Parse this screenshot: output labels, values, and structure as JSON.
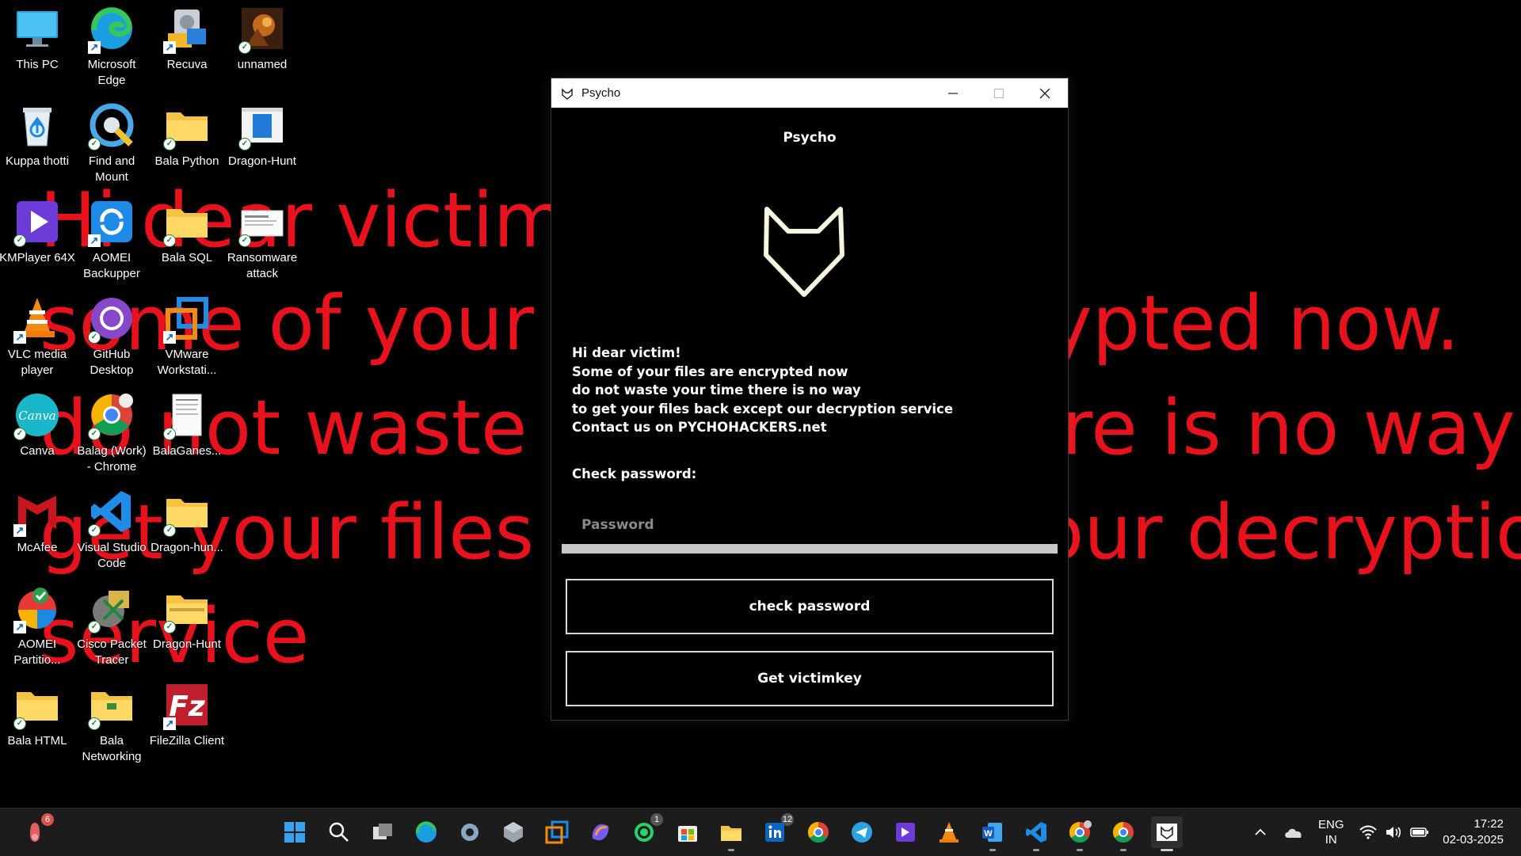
{
  "wallpaper": {
    "lines": [
      "Hi dear victim!",
      "some of your files are encrypted now.",
      "do not waste your time there is no way to",
      "get your files back except our decryption",
      "service"
    ],
    "color": "#e8121c"
  },
  "desktop_icons": [
    {
      "label": "This PC",
      "icon": "monitor-icon"
    },
    {
      "label": "Microsoft Edge",
      "icon": "edge-icon"
    },
    {
      "label": "Recuva",
      "icon": "recuva-icon"
    },
    {
      "label": "unnamed",
      "icon": "image-thumbnail-icon"
    },
    {
      "label": "Kuppa thotti",
      "icon": "recycle-bin-icon"
    },
    {
      "label": "Find and Mount",
      "icon": "find-and-mount-icon"
    },
    {
      "label": "Bala Python",
      "icon": "folder-icon"
    },
    {
      "label": "Dragon-Hunt",
      "icon": "app-icon"
    },
    {
      "label": "KMPlayer 64X",
      "icon": "kmplayer-icon"
    },
    {
      "label": "AOMEI Backupper",
      "icon": "aomei-backupper-icon"
    },
    {
      "label": "Bala SQL",
      "icon": "folder-icon"
    },
    {
      "label": "Ransomware attack",
      "icon": "document-icon"
    },
    {
      "label": "VLC media player",
      "icon": "vlc-icon"
    },
    {
      "label": "GitHub Desktop",
      "icon": "github-icon"
    },
    {
      "label": "VMware Workstati...",
      "icon": "vmware-icon"
    },
    {
      "label": "Canva",
      "icon": "canva-icon"
    },
    {
      "label": "Balag (Work) - Chrome",
      "icon": "chrome-icon"
    },
    {
      "label": "BalaGanes...",
      "icon": "document-icon"
    },
    {
      "label": "McAfee",
      "icon": "mcafee-icon"
    },
    {
      "label": "Visual Studio Code",
      "icon": "vscode-icon"
    },
    {
      "label": "Dragon-hun...",
      "icon": "folder-icon"
    },
    {
      "label": "AOMEI Partitio...",
      "icon": "aomei-partition-icon"
    },
    {
      "label": "Cisco Packet Tracer",
      "icon": "cisco-packet-tracer-icon"
    },
    {
      "label": "Dragon-Hunt",
      "icon": "zip-folder-icon"
    },
    {
      "label": "Bala HTML",
      "icon": "folder-icon"
    },
    {
      "label": "Bala Networking",
      "icon": "folder-icon"
    },
    {
      "label": "FileZilla Client",
      "icon": "filezilla-icon"
    }
  ],
  "window": {
    "title": "Psycho",
    "heading": "Psycho",
    "message_lines": [
      "Hi dear victim!",
      "Some of your files are encrypted now",
      "do not waste your time there is no way",
      "to get your files back except our decryption service",
      "Contact us on PYCHOHACKERS.net"
    ],
    "check_label": "Check password:",
    "password_placeholder": "Password",
    "check_button": "check password",
    "victimkey_button": "Get victimkey"
  },
  "taskbar": {
    "notification_count": "6",
    "whatsapp_count": "1",
    "linkedin_count": "12",
    "language": "ENG",
    "region": "IN",
    "time": "17:22",
    "date": "02-03-2025"
  }
}
